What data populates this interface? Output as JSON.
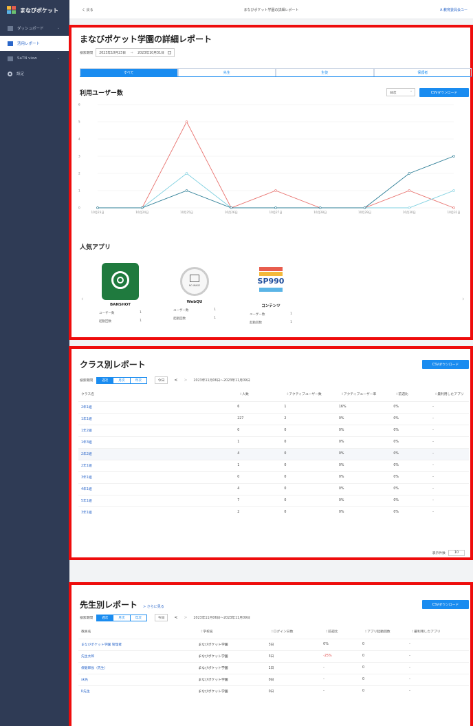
{
  "sidebar": {
    "logo": "まなびポケット",
    "items": [
      {
        "label": "ダッシュボード",
        "chev": "⌄"
      },
      {
        "label": "活用レポート"
      },
      {
        "label": "SaTN view",
        "chev": "⌄"
      },
      {
        "label": "設定"
      }
    ]
  },
  "topbar": {
    "back": "く 戻る",
    "title": "まなびポケット学園の詳細レポート",
    "user": "A 教育委員会ユー"
  },
  "detail": {
    "title": "まなびポケット学園の詳細レポート",
    "period_label": "検索期間",
    "date_from": "2023年10月23日",
    "date_sep": "→",
    "date_to": "2023年10月31日",
    "tabs": [
      "すべて",
      "先生",
      "生徒",
      "保護者"
    ],
    "users_heading": "利用ユーザー数",
    "unit_select": "日次",
    "csv_button": "CSVダウンロード",
    "popular_heading": "人気アプリ",
    "apps": [
      {
        "name": "BANSHOT",
        "users_label": "ユーザー数",
        "users": "1",
        "starts_label": "起動回数",
        "starts": "1",
        "icon": "banshot-icon"
      },
      {
        "name": "WebQU",
        "users_label": "ユーザー数",
        "users": "1",
        "starts_label": "起動回数",
        "starts": "1",
        "icon": "no-image-icon",
        "icon_text": "NO IMAGE"
      },
      {
        "name": "コンテンツ",
        "users_label": "ユーザー数",
        "users": "1",
        "starts_label": "起動回数",
        "starts": "1",
        "icon": "sp990-icon",
        "icon_text": "SP990"
      }
    ],
    "carousel_left": "‹",
    "carousel_right": "›"
  },
  "chart_data": {
    "type": "line",
    "categories": [
      "10月23日",
      "10月24日",
      "10月25日",
      "10月26日",
      "10月27日",
      "10月28日",
      "10月29日",
      "10月30日",
      "10月31日"
    ],
    "ylim": [
      0,
      6
    ],
    "yticks": [
      "0",
      "1",
      "2",
      "3",
      "4",
      "5",
      "6"
    ],
    "grid": true,
    "series": [
      {
        "color": "#e8736f",
        "values": [
          0,
          0,
          5,
          0,
          1,
          0,
          0,
          1,
          0
        ]
      },
      {
        "color": "#7fd0e0",
        "values": [
          0,
          0,
          2,
          0,
          0,
          0,
          0,
          0,
          1
        ]
      },
      {
        "color": "#2e7f97",
        "values": [
          0,
          0,
          1,
          0,
          0,
          0,
          0,
          2,
          3
        ]
      }
    ]
  },
  "class_report": {
    "title": "クラス別レポート",
    "csv_button": "CSVダウンロード",
    "period_label": "検索期間",
    "seg": [
      "週次",
      "月次",
      "年次"
    ],
    "today": "今日",
    "prev": "<",
    "next": ">",
    "range": "2023年11月06日〜2023年11月09日",
    "headers": [
      "クラス名",
      "人数",
      "アクティブユーザー数",
      "アクティブユーザー率",
      "前週比",
      "最利用したアプリ"
    ],
    "sort_mark": "⇕",
    "rows": [
      [
        "2年1組",
        "6",
        "1",
        "16%",
        "0%",
        "-"
      ],
      [
        "1年1組",
        "227",
        "2",
        "0%",
        "0%",
        "-"
      ],
      [
        "1年2組",
        "0",
        "0",
        "0%",
        "0%",
        "-"
      ],
      [
        "1年3組",
        "1",
        "0",
        "0%",
        "0%",
        "-"
      ],
      [
        "2年2組",
        "4",
        "0",
        "0%",
        "0%",
        "-"
      ],
      [
        "2年1組",
        "1",
        "0",
        "0%",
        "0%",
        "-"
      ],
      [
        "3年1組",
        "0",
        "0",
        "0%",
        "0%",
        "-"
      ],
      [
        "4年1組",
        "4",
        "0",
        "0%",
        "0%",
        "-"
      ],
      [
        "5年1組",
        "7",
        "0",
        "0%",
        "0%",
        "-"
      ],
      [
        "3年1組",
        "2",
        "0",
        "0%",
        "0%",
        "-"
      ]
    ],
    "page_size_label": "表示件数",
    "page_size": "10"
  },
  "teacher_report": {
    "title": "先生別レポート",
    "more_link": "> さらに見る",
    "csv_button": "CSVダウンロード",
    "period_label": "検索期間",
    "seg": [
      "週次",
      "月次",
      "年次"
    ],
    "today": "今日",
    "prev": "<",
    "next": ">",
    "range": "2023年11月06日〜2023年11月09日",
    "headers": [
      "教員名",
      "学校名",
      "ログイン日数",
      "前週比",
      "アプリ起動回数",
      "最利用したアプリ"
    ],
    "sort_mark": "⇕",
    "rows": [
      [
        "まなびポケット学園 管理者",
        "まなびポケット学園",
        "3日",
        "0%",
        "0",
        "-"
      ],
      [
        "先生太郎",
        "まなびポケット学園",
        "3日",
        "-25%",
        "0",
        "-"
      ],
      [
        "保健師長（先生）",
        "まなびポケット学園",
        "1日",
        "-",
        "0",
        "-"
      ],
      [
        "sk先",
        "まなびポケット学園",
        "0日",
        "-",
        "0",
        "-"
      ],
      [
        "K先生",
        "まなびポケット学園",
        "0日",
        "-",
        "0",
        "-"
      ]
    ]
  }
}
